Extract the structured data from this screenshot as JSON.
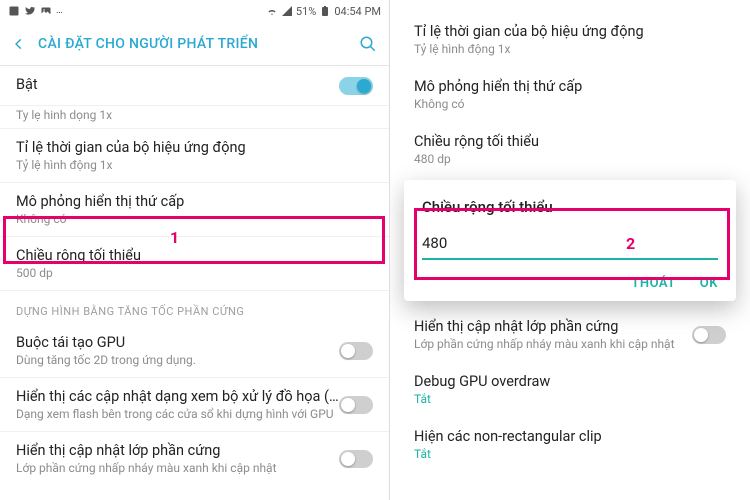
{
  "status": {
    "battery_pct": "51%",
    "time": "04:54 PM"
  },
  "header": {
    "title": "CÀI ĐẶT CHO NGƯỜI PHÁT TRIỂN"
  },
  "left": {
    "master": {
      "label": "Bật"
    },
    "clip_sub": "Ty lẹ hinh dọng 1x",
    "row_anim": {
      "title": "Tỉ lệ thời gian của bộ hiệu ứng động",
      "sub": "Tỷ lệ hình động 1x"
    },
    "row_secondary": {
      "title": "Mô phỏng hiển thị thứ cấp",
      "sub": "Không có"
    },
    "row_width": {
      "title": "Chiều rộng tối thiểu",
      "sub": "500 dp"
    },
    "section_hw": "DỰNG HÌNH BẰNG TĂNG TỐC PHẦN CỨNG",
    "row_gpu": {
      "title": "Buộc tái tạo GPU",
      "sub": "Dùng tăng tốc 2D trong ứng dụng."
    },
    "row_gpuview": {
      "title": "Hiển thị các cập nhật dạng xem bộ xử lý đồ họa (G..",
      "sub": "Dạng xem flash bên trong các cửa sổ khi dựng hình với GPU"
    },
    "row_hwlayer": {
      "title": "Hiển thị cập nhật lớp phần cứng",
      "sub": "Lớp phần cứng nhấp nháy màu xanh khi cập nhật"
    }
  },
  "right": {
    "row_anim": {
      "title": "Tỉ lệ thời gian của bộ hiệu ứng động",
      "sub": "Tỷ lệ hình động 1x"
    },
    "row_secondary": {
      "title": "Mô phỏng hiển thị thứ cấp",
      "sub": "Không có"
    },
    "row_width": {
      "title": "Chiều rộng tối thiểu",
      "sub": "480 dp"
    },
    "row_hwlayer": {
      "title": "Hiển thị cập nhật lớp phần cứng",
      "sub": "Lớp phần cứng nhấp nháy màu xanh khi cập nhật"
    },
    "row_overdraw": {
      "title": "Debug GPU overdraw",
      "sub": "Tắt"
    },
    "row_clip": {
      "title": "Hiện các non-rectangular clip",
      "sub": "Tắt"
    }
  },
  "dialog": {
    "title": "Chiều rộng tối thiểu",
    "value": "480",
    "cancel": "THOÁT",
    "ok": "OK"
  },
  "callouts": {
    "one": "1",
    "two": "2"
  }
}
